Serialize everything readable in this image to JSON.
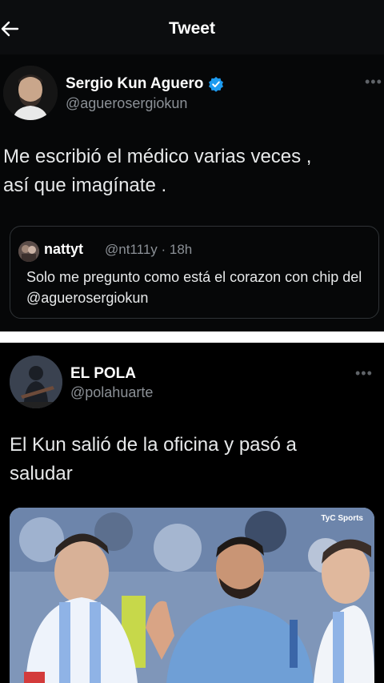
{
  "header": {
    "title": "Tweet",
    "back_icon": "arrow-left-icon"
  },
  "tweet1": {
    "author_name": "Sergio Kun Aguero",
    "author_handle": "@aguerosergiokun",
    "verified": true,
    "text_line1": "Me escribió el médico varias veces ,",
    "text_line2": "así que imagínate .",
    "quote": {
      "name": "nattyt",
      "meta": "@nt111y · 18h",
      "text": "Solo me pregunto como está el corazon con chip del @aguerosergiokun"
    }
  },
  "tweet2": {
    "author_name": "EL POLA",
    "author_handle": "@polahuarte",
    "text_line1": "El Kun salió de la oficina y pasó a",
    "text_line2": "saludar",
    "media_watermark": "TyC Sports"
  },
  "colors": {
    "verified": "#1d9bf0",
    "muted": "#8b9096",
    "separator": "#ffffff"
  }
}
